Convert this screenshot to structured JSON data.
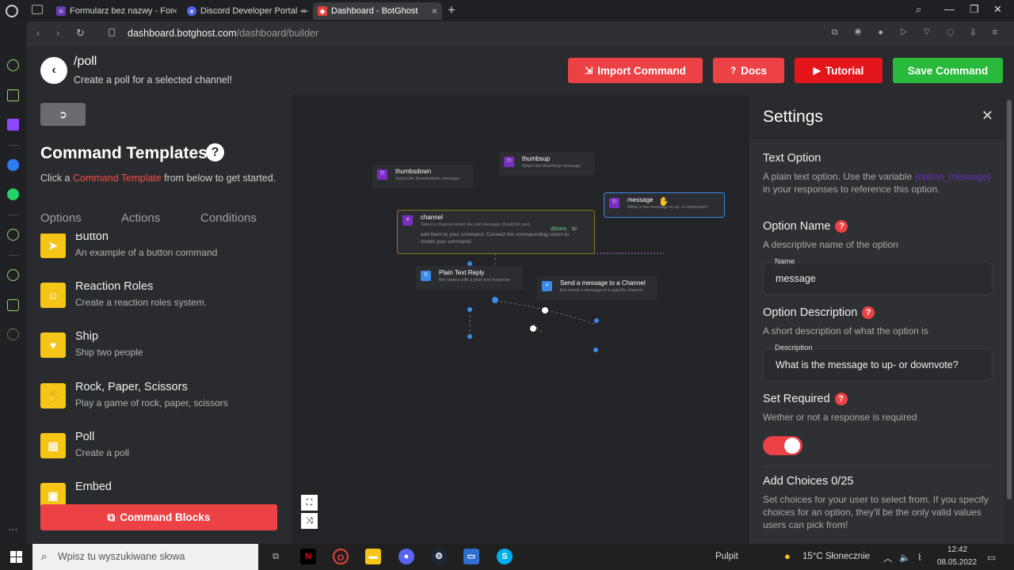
{
  "browser": {
    "tabs": [
      {
        "label": "Formularz bez nazwy - For",
        "icon": "forms-icon",
        "color": "#673ab7"
      },
      {
        "label": "Discord Developer Portal —",
        "icon": "discord-icon",
        "color": "#5865f2"
      },
      {
        "label": "Dashboard - BotGhost",
        "icon": "botghost-icon",
        "color": "#e8413c"
      }
    ],
    "url_host": "dashboard.botghost.com",
    "url_path": "/dashboard/builder"
  },
  "header": {
    "command_name": "/poll",
    "command_description": "Create a poll for a selected channel!",
    "buttons": [
      {
        "label": "Import Command",
        "color": "#ed4245",
        "icon": "file-import-icon"
      },
      {
        "label": "Docs",
        "color": "#ed4245",
        "icon": "question-circle-icon"
      },
      {
        "label": "Tutorial",
        "color": "#e3161b",
        "icon": "youtube-icon"
      },
      {
        "label": "Save Command",
        "color": "#29b93b",
        "icon": ""
      }
    ]
  },
  "left_panel": {
    "title": "Command Templates",
    "subtitle_before": "Click a ",
    "subtitle_link": "Command Template",
    "subtitle_after": " from below to get started.",
    "tabs": [
      "Options",
      "Actions",
      "Conditions"
    ],
    "templates": [
      {
        "name": "Button",
        "description": "An example of a button command",
        "icon": "pointer-icon"
      },
      {
        "name": "Reaction Roles",
        "description": "Create a reaction roles system.",
        "icon": "smile-icon"
      },
      {
        "name": "Ship",
        "description": "Ship two people",
        "icon": "heart-icon"
      },
      {
        "name": "Rock, Paper, Scissors",
        "description": "Play a game of rock, paper, scissors",
        "icon": "hand-icon"
      },
      {
        "name": "Poll",
        "description": "Create a poll",
        "icon": "bar-chart-icon"
      },
      {
        "name": "Embed",
        "description": "",
        "icon": "embed-icon"
      }
    ],
    "blocks_button": "Command Blocks"
  },
  "canvas": {
    "nodes": [
      {
        "title": "thumbsdown",
        "description": "Select the thumbsdown message",
        "icon_label": "T!",
        "icon_color": "#7b2fbf"
      },
      {
        "title": "thumbsup",
        "description": "Select the thumbsup message",
        "icon_label": "T!",
        "icon_color": "#7b2fbf"
      },
      {
        "title": "message",
        "description": "What is the message to up- or downvote?",
        "icon_label": "T!",
        "icon_color": "#7b2fbf"
      },
      {
        "title": "channel",
        "description": "Select a channel where the poll message should be sent",
        "icon_label": "#",
        "icon_color": "#7b2fbf"
      },
      {
        "title": "Plain Text Reply",
        "description": "Bot replies with a plain text response",
        "icon_label": "Tr",
        "icon_color": "#3a8be8"
      },
      {
        "title": "Send a message to a Channel",
        "description": "Bot sends a message to a specific channel",
        "icon_label": "#",
        "icon_color": "#3a8be8"
      }
    ],
    "overlay_text": "add them to your command. Connect the corresponding colors to create your command.",
    "overlay_highlight": "ditions",
    "overlay_highlight_after": "to"
  },
  "settings": {
    "title": "Settings",
    "section_title": "Text Option",
    "section_desc_before": "A plain text option. Use the variable",
    "section_var": "{option_message}",
    "section_desc_after": "in your responses to reference this option.",
    "option_name_label": "Option Name",
    "option_name_desc": "A descriptive name of the option",
    "name_field_label": "Name",
    "name_field_value": "message",
    "option_desc_label": "Option Description",
    "option_desc_desc": "A short description of what the option is",
    "desc_field_label": "Description",
    "desc_field_value": "What is the message to up- or downvote?",
    "required_label": "Set Required",
    "required_desc": "Wether or not a response is required",
    "required_on": true,
    "choices_label": "Add Choices 0/25",
    "choices_desc": "Set choices for your user to select from. If you specify choices for an option, they'll be the only valid values users can pick from!"
  },
  "taskbar": {
    "search_placeholder": "Wpisz tu wyszukiwane słowa",
    "desktop_label": "Pulpit",
    "weather": "15°C Słonecznie",
    "time": "12:42",
    "date": "08.05.2022"
  },
  "colors": {
    "accent_red": "#ed4245",
    "accent_green": "#29b93b",
    "template_yellow": "#f5c518"
  }
}
